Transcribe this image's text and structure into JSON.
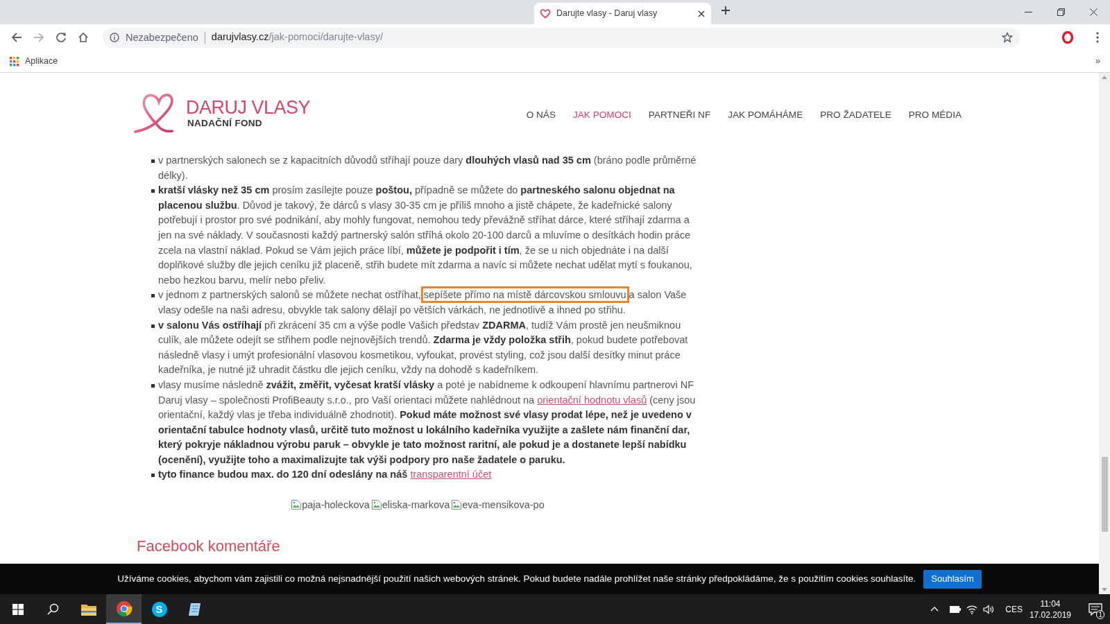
{
  "browser": {
    "tabs": [
      {
        "title": "Darujte vlasy - Daruj vlasy",
        "selected": true
      }
    ],
    "nav_buttons": [
      {
        "kind": "back",
        "disabled": false
      },
      {
        "kind": "forward",
        "disabled": true
      },
      {
        "kind": "reload",
        "disabled": false
      },
      {
        "kind": "home",
        "disabled": false
      }
    ],
    "address": {
      "security": "Nezabezpečeno",
      "domain": "darujvlasy.cz",
      "path": "/jak-pomoci/darujte-vlasy/"
    },
    "bookmarks": [
      {
        "label": "Aplikace"
      }
    ],
    "bookmarks_overflow": "»"
  },
  "site": {
    "logo": {
      "title": "DARUJ VLASY",
      "subtitle": "NADAČNÍ FOND"
    },
    "menu": [
      {
        "label": "O NÁS",
        "selected": false
      },
      {
        "label": "JAK POMOCI",
        "selected": true
      },
      {
        "label": "PARTNEŘI NF",
        "selected": false
      },
      {
        "label": "JAK POMÁHÁME",
        "selected": false
      },
      {
        "label": "PRO ŽADATELE",
        "selected": false
      },
      {
        "label": "PRO MÉDIA",
        "selected": false
      }
    ]
  },
  "article": {
    "items": [
      {
        "segments": [
          {
            "kind": "text",
            "text": "v partnerských salonech se z kapacitních důvodů stříhají pouze dary **dlouhých vlasů nad 35 cm** (bráno podle průměrné délky)."
          }
        ]
      },
      {
        "segments": [
          {
            "kind": "text",
            "text": "**kratší vlásky než 35 cm** prosím zasílejte pouze **poštou,** případně se můžete do **partneského salonu objednat na placenou službu**. Důvod je takový, že dárců s vlasy 30-35 cm je příliš mnoho a jistě chápete, že kadeřnické salony potřebují i prostor pro své podnikání, aby mohly fungovat, nemohou tedy převážně stříhat dárce, které stříhají zdarma a jen na své náklady. V současnosti každý partnerský salón stříhá okolo 20-100 darců a mluvíme o desítkách hodin práce zcela na vlastní náklad. Pokud se Vám jejich práce líbí, **můžete je podpořit i tím**, že se u nich objednáte i na další doplňkové služby dle jejich ceníku již placeně, střih budete mít zdarma a navíc si můžete nechat udělat mytí s foukanou, nebo hezkou barvu, melír nebo přeliv."
          }
        ]
      },
      {
        "segments": [
          {
            "kind": "text",
            "text": "v jednom z partnerských salonů se můžete nechat ostříhat, "
          },
          {
            "kind": "framed",
            "text": "sepíšete přímo na místě dárcovskou smlouvu"
          },
          {
            "kind": "text",
            "text": " a salon Vaše vlasy odešle na naši adresu, obvykle tak salony dělají po větších várkách, ne jednotlivě a ihned po střihu."
          }
        ]
      },
      {
        "segments": [
          {
            "kind": "text",
            "text": "**v salonu Vás ostříhají** při zkrácení 35 cm a výše podle Vašich představ **ZDARMA**, tudíž Vám prostě jen neušmiknou culík, ale můžete odejít se střihem podle nejnovějších trendů. **Zdarma je vždy položka střih**, pokud budete potřebovat následně vlasy i umýt profesionální vlasovou kosmetikou, vyfoukat, provést styling, což jsou další desítky minut práce kadeřníka, je nutné již uhradit částku dle jejich ceníku, vždy na dohodě s kadeřníkem."
          }
        ]
      },
      {
        "segments": [
          {
            "kind": "text",
            "text": "vlasy musíme následně **zvážit, změřit, vyčesat kratší vlásky** a poté je nabídneme k odkoupení hlavnímu partnerovi NF Daruj vlasy – společnosti ProfiBeauty s.r.o., pro Vaší orientaci můžete nahlédnout na "
          },
          {
            "kind": "link",
            "text": "orientační hodnotu vlasů"
          },
          {
            "kind": "text",
            "text": " (ceny jsou orientační, každý vlas je třeba individuálně zhodnotit). **Pokud máte možnost své vlasy prodat lépe, než je uvedeno v orientační tabulce hodnoty vlasů, určitě tuto možnost u lokálního kadeřníka využijte a zašlete nám finanční dar, který pokryje nákladnou výrobu paruk – obvykle je tato možnost raritní, ale pokud je a dostanete lepší nabídku (ocenění), využijte toho a maximalizujte tak výši podpory pro naše žadatele o paruku.**"
          }
        ]
      },
      {
        "segments": [
          {
            "kind": "text",
            "text": "**tyto finance budou max. do 120 dní odeslány na náš** "
          },
          {
            "kind": "link",
            "text": "transparentní účet"
          }
        ]
      }
    ],
    "images": [
      {
        "alt": "paja-holeckova"
      },
      {
        "alt": "eliska-markova"
      },
      {
        "alt": "eva-mensikova-po"
      }
    ],
    "comments_heading": "Facebook komentáře"
  },
  "cookie_bar": {
    "text": "Užíváme cookies, abychom vám zajistili co možná nejsnadnější použití našich webových stránek. Pokud budete nadále prohlížet naše stránky předpokládáme, že s použitím cookies souhlasíte.",
    "button": "Souhlasím"
  },
  "taskbar": {
    "apps": [
      {
        "kind": "files",
        "selected": false
      },
      {
        "kind": "browser",
        "selected": true
      },
      {
        "kind": "messenger",
        "selected": false,
        "glyph": "S"
      },
      {
        "kind": "notes",
        "selected": false
      }
    ],
    "language": "CES",
    "time": "11:04",
    "date": "17.02.2019",
    "notifications": "1"
  }
}
